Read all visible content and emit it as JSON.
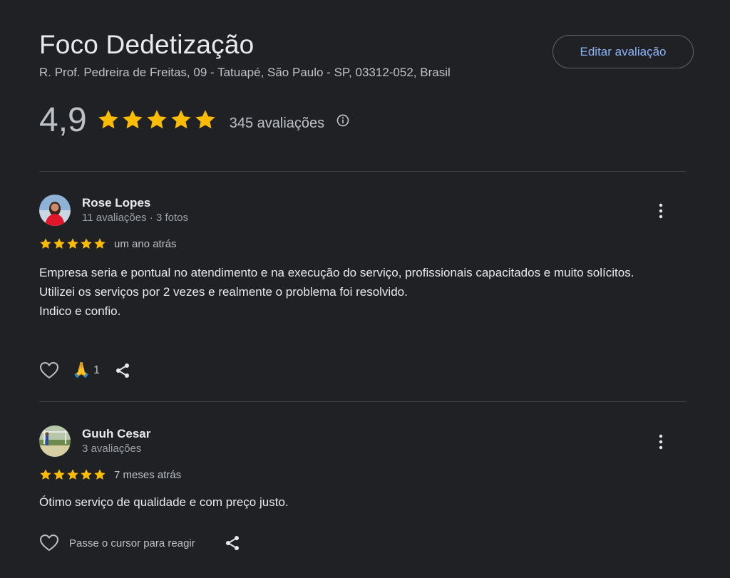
{
  "place": {
    "name": "Foco Dedetização",
    "address": "R. Prof. Pedreira de Freitas, 09 - Tatuapé, São Paulo - SP, 03312-052, Brasil",
    "edit_review_label": "Editar avaliação",
    "rating_value": "4,9",
    "rating_stars": 5,
    "review_count": "345 avaliações",
    "info_icon": "info-circle-icon"
  },
  "colors": {
    "background": "#202124",
    "star": "#fbbc04",
    "accent_link": "#8ab4f8",
    "divider": "#3c4043"
  },
  "reviews": [
    {
      "author": "Rose Lopes",
      "meta": "11 avaliações · 3 fotos",
      "stars": 5,
      "time": "um ano atrás",
      "text_lines": [
        "Empresa seria e pontual no atendimento e na execução do serviço, profissionais capacitados e muito solícitos.",
        "Utilizei os serviços por 2 vezes e realmente o problema foi resolvido.",
        "Indico e confio."
      ],
      "reaction_emoji": "🙏",
      "reaction_count": "1"
    },
    {
      "author": "Guuh Cesar",
      "meta": "3 avaliações",
      "stars": 5,
      "time": "7 meses atrás",
      "text_lines": [
        "Ótimo serviço de qualidade e com preço justo."
      ],
      "hover_hint": "Passe o cursor para reagir"
    }
  ]
}
